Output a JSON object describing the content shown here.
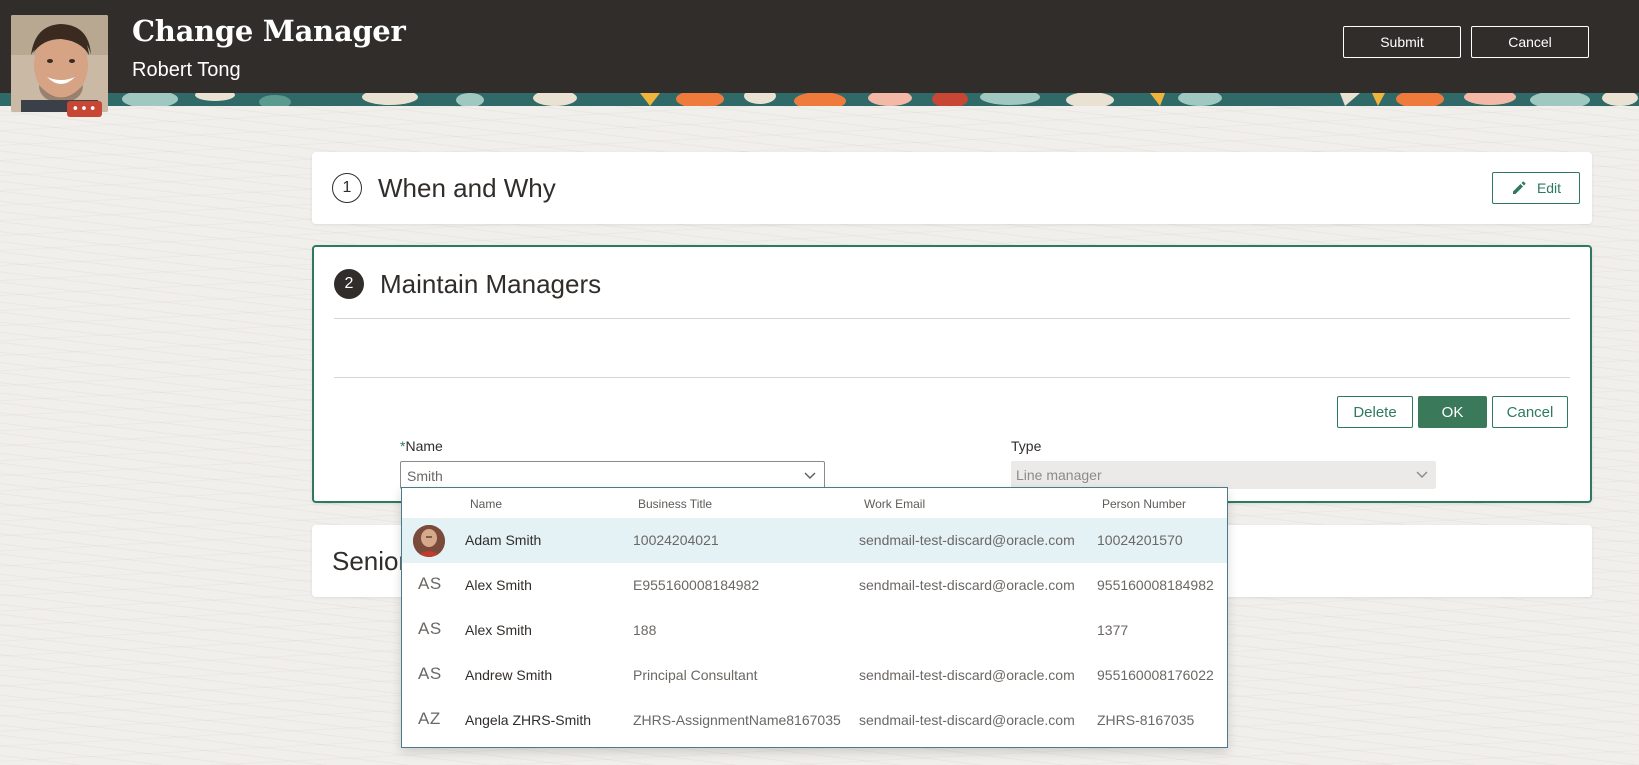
{
  "header": {
    "title": "Change Manager",
    "subtitle": "Robert Tong",
    "submit_label": "Submit",
    "cancel_label": "Cancel",
    "avatar_more": "•••"
  },
  "sections": {
    "when_why": {
      "number": "1",
      "title": "When and Why",
      "edit_label": "Edit"
    },
    "maintain": {
      "number": "2",
      "title": "Maintain Managers",
      "delete_label": "Delete",
      "ok_label": "OK",
      "cancel_label": "Cancel",
      "name_label": "Name",
      "required_mark": "*",
      "name_value": "Smith",
      "type_label": "Type",
      "type_value": "Line manager"
    },
    "third": {
      "title": "Senior"
    }
  },
  "dropdown": {
    "columns": {
      "name": "Name",
      "title": "Business Title",
      "email": "Work Email",
      "number": "Person Number"
    },
    "rows": [
      {
        "initials": "",
        "name": "Adam Smith",
        "title": "10024204021",
        "email": "sendmail-test-discard@oracle.com",
        "number": "10024201570"
      },
      {
        "initials": "AS",
        "name": "Alex Smith",
        "title": "E955160008184982",
        "email": "sendmail-test-discard@oracle.com",
        "number": "955160008184982"
      },
      {
        "initials": "AS",
        "name": "Alex Smith",
        "title": "188",
        "email": "",
        "number": "1377"
      },
      {
        "initials": "AS",
        "name": "Andrew Smith",
        "title": "Principal Consultant",
        "email": "sendmail-test-discard@oracle.com",
        "number": "955160008176022"
      },
      {
        "initials": "AZ",
        "name": "Angela ZHRS-Smith",
        "title": "ZHRS-AssignmentName8167035",
        "email": "sendmail-test-discard@oracle.com",
        "number": "ZHRS-8167035"
      }
    ]
  },
  "colors": {
    "header_bg": "#312d2a",
    "accent_green": "#2d7a61",
    "ok_green": "#3a7a5b",
    "highlight_row": "#e4f1f5"
  }
}
